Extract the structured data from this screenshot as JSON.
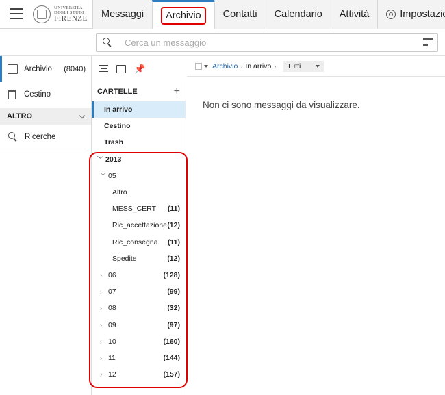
{
  "logo": {
    "line1": "UNIVERSITÀ",
    "line2": "DEGLI STUDI",
    "line3": "FIRENZE"
  },
  "tabs": [
    "Messaggi",
    "Archivio",
    "Contatti",
    "Calendario",
    "Attività",
    "Impostazioni"
  ],
  "search": {
    "placeholder": "Cerca un messaggio"
  },
  "sidebar": {
    "archivio_label": "Archivio",
    "archivio_count": "(8040)",
    "cestino_label": "Cestino",
    "altro_label": "ALTRO",
    "ricerche_label": "Ricerche"
  },
  "folders": {
    "header": "CARTELLE",
    "in_arrivo": "In arrivo",
    "cestino": "Cestino",
    "trash": "Trash",
    "year": "2013",
    "month_05": "05",
    "subs": [
      {
        "label": "Altro",
        "count": ""
      },
      {
        "label": "MESS_CERT",
        "count": "(11)"
      },
      {
        "label": "Ric_accettazione",
        "count": "(12)"
      },
      {
        "label": "Ric_consegna",
        "count": "(11)"
      },
      {
        "label": "Spedite",
        "count": "(12)"
      }
    ],
    "months": [
      {
        "label": "06",
        "count": "(128)"
      },
      {
        "label": "07",
        "count": "(99)"
      },
      {
        "label": "08",
        "count": "(32)"
      },
      {
        "label": "09",
        "count": "(97)"
      },
      {
        "label": "10",
        "count": "(160)"
      },
      {
        "label": "11",
        "count": "(144)"
      },
      {
        "label": "12",
        "count": "(157)"
      }
    ]
  },
  "breadcrumb": {
    "root": "Archivio",
    "current": "In arrivo",
    "filter": "Tutti"
  },
  "content": {
    "empty_message": "Non ci sono messaggi da visualizzare."
  },
  "colors": {
    "accent": "#2b7cc0",
    "highlight": "#e00000",
    "active_bg": "#d9ecf9"
  }
}
